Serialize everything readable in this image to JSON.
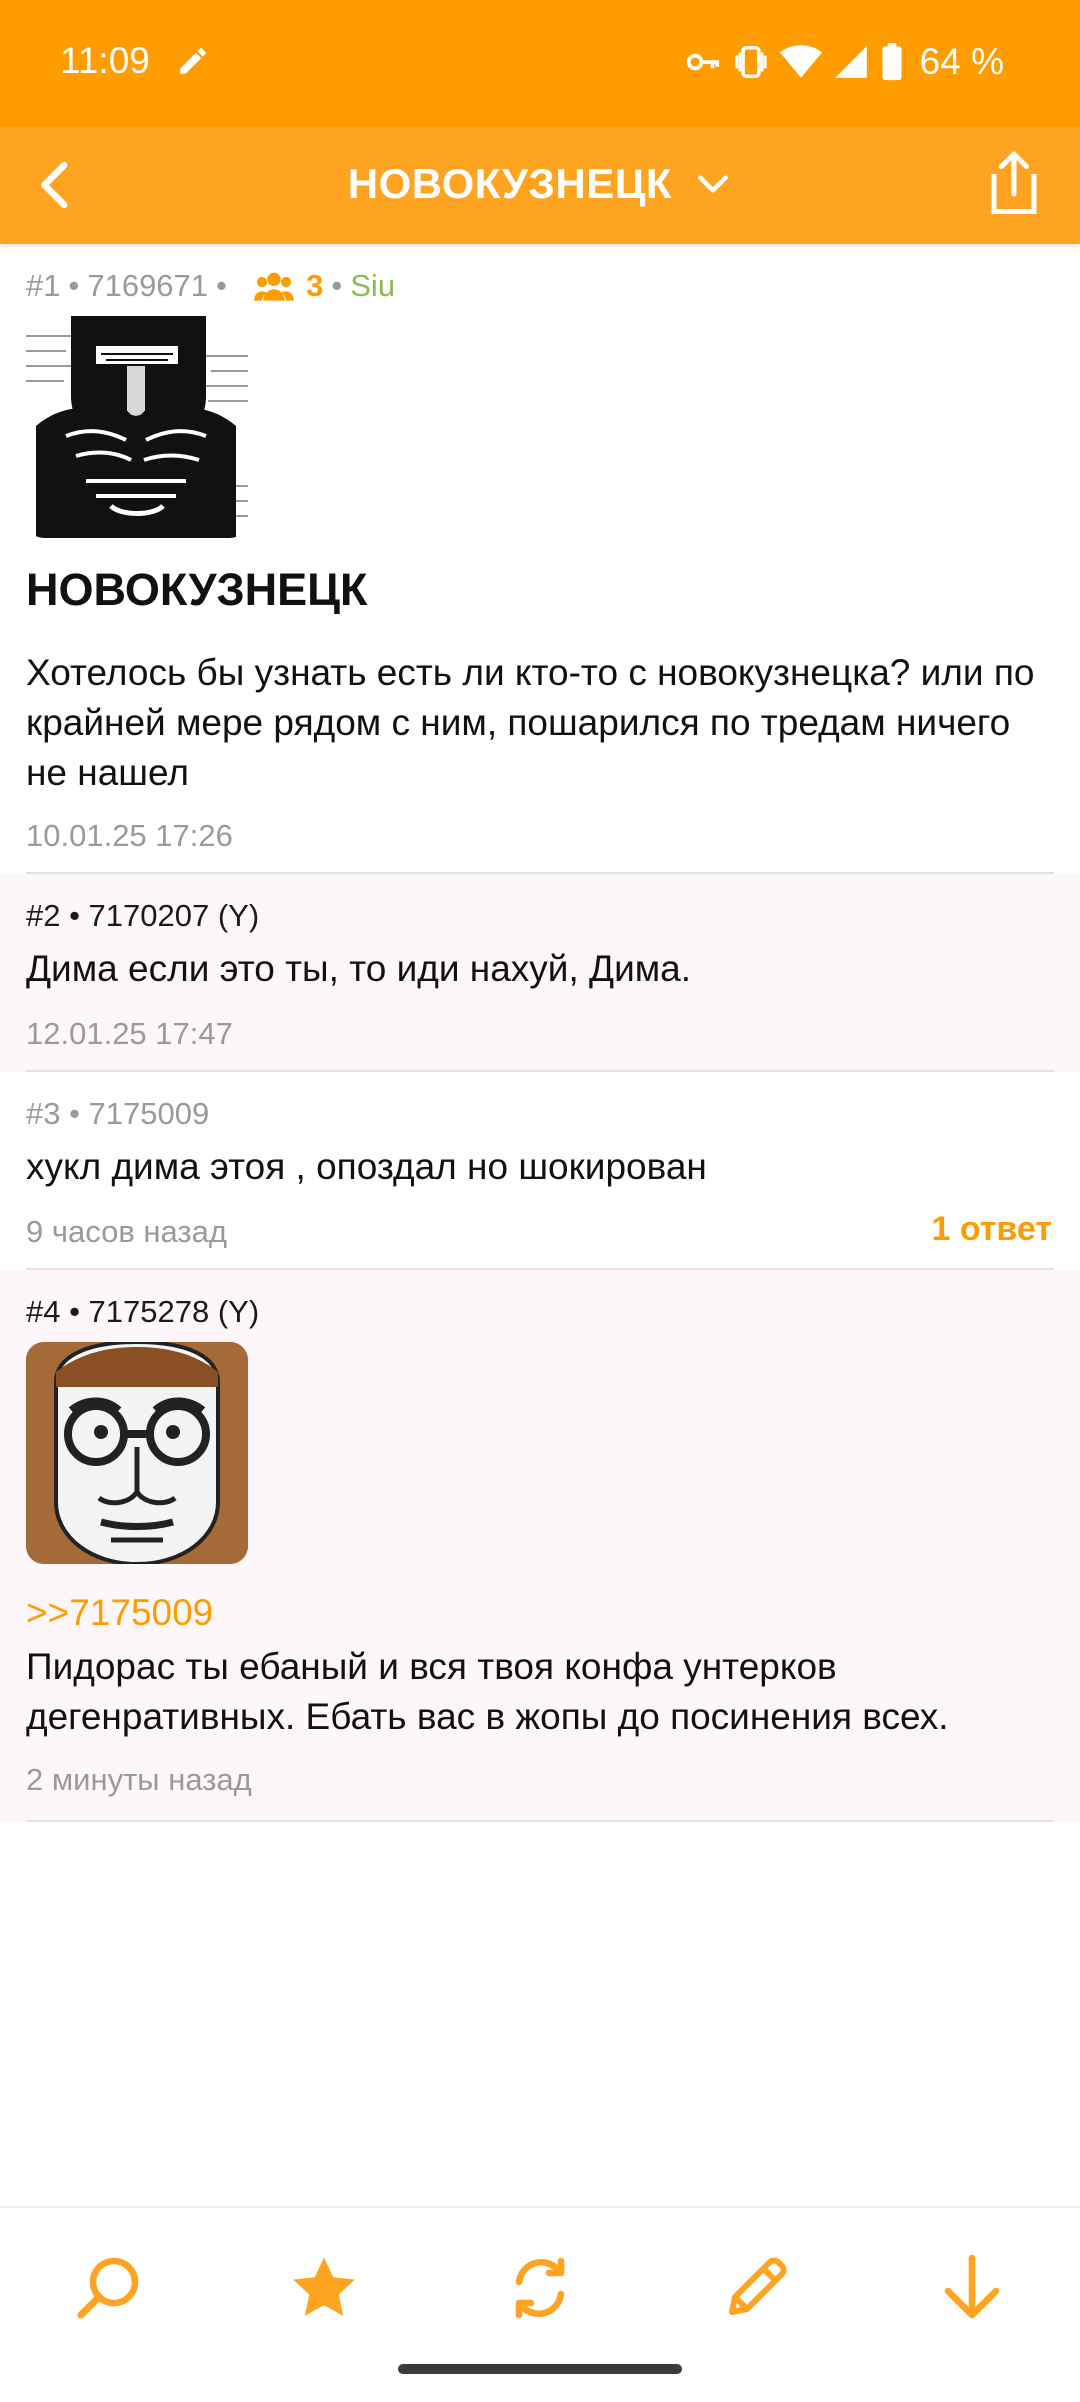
{
  "status_bar": {
    "time": "11:09",
    "battery": "64 %"
  },
  "app_bar": {
    "title": "НОВОКУЗНЕЦК"
  },
  "posts": [
    {
      "meta_num": "#1",
      "meta_id": "7169671",
      "participants": "3",
      "name": "Siu",
      "title": "НОВОКУЗНЕЦК",
      "body": "Хотелось бы узнать есть ли кто-то с новокузнецка? или по крайней мере рядом с ним, пошарился по тредам ничего не нашел",
      "time": "10.01.25 17:26"
    },
    {
      "meta": "#2 • 7170207 (Y)",
      "body": "Дима если это ты, то иди нахуй, Дима.",
      "time": "12.01.25 17:47"
    },
    {
      "meta": "#3 • 7175009",
      "body": "хукл дима этоя , опоздал но шокирован",
      "time": "9 часов назад",
      "replies": "1 ответ"
    },
    {
      "meta": "#4 • 7175278 (Y)",
      "reply_to": ">>7175009",
      "body": "Пидорас ты ебаный и вся твоя конфа унтерков дегенративных. Ебать вас в жопы до посинения всех.",
      "time": "2 минуты назад"
    }
  ],
  "colors": {
    "accent": "#ff9c00",
    "appbar": "#ffa420",
    "name_green": "#8dbb4f",
    "alt_row": "#fdf7fc"
  },
  "icons": [
    "edit-icon",
    "key-icon",
    "vibrate-icon",
    "wifi-icon",
    "signal-icon",
    "battery-icon",
    "back-icon",
    "chevron-down-icon",
    "share-icon",
    "users-icon",
    "search-icon",
    "star-icon",
    "refresh-icon",
    "pencil-icon",
    "arrow-down-icon"
  ]
}
